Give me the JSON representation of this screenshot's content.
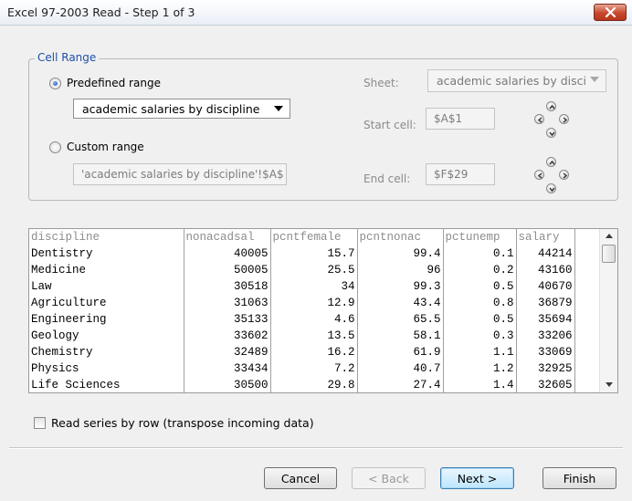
{
  "window": {
    "title": "Excel 97-2003 Read - Step 1 of 3"
  },
  "cell_range": {
    "legend": "Cell Range",
    "predefined_label": "Predefined range",
    "predefined_selected": "academic salaries by discipline",
    "custom_label": "Custom range",
    "custom_value": "'academic salaries by discipline'!$A$",
    "sheet_label": "Sheet:",
    "sheet_value": "academic salaries by disci",
    "start_label": "Start cell:",
    "start_value": "$A$1",
    "end_label": "End cell:",
    "end_value": "$F$29"
  },
  "grid": {
    "headers": [
      "discipline",
      "nonacadsal",
      "pcntfemale",
      "pcntnonac",
      "pctunemp",
      "salary"
    ],
    "rows": [
      [
        "Dentistry",
        "40005",
        "15.7",
        "99.4",
        "0.1",
        "44214"
      ],
      [
        "Medicine",
        "50005",
        "25.5",
        "96",
        "0.2",
        "43160"
      ],
      [
        "Law",
        "30518",
        "34",
        "99.3",
        "0.5",
        "40670"
      ],
      [
        "Agriculture",
        "31063",
        "12.9",
        "43.4",
        "0.8",
        "36879"
      ],
      [
        "Engineering",
        "35133",
        "4.6",
        "65.5",
        "0.5",
        "35694"
      ],
      [
        "Geology",
        "33602",
        "13.5",
        "58.1",
        "0.3",
        "33206"
      ],
      [
        "Chemistry",
        "32489",
        "16.2",
        "61.9",
        "1.1",
        "33069"
      ],
      [
        "Physics",
        "33434",
        "7.2",
        "40.7",
        "1.2",
        "32925"
      ],
      [
        "Life Sciences",
        "30500",
        "29.8",
        "27.4",
        "1.4",
        "32605"
      ]
    ]
  },
  "options": {
    "transpose_label": "Read series by row (transpose incoming data)"
  },
  "buttons": {
    "cancel": "Cancel",
    "back": "< Back",
    "next": "Next >",
    "finish": "Finish"
  }
}
